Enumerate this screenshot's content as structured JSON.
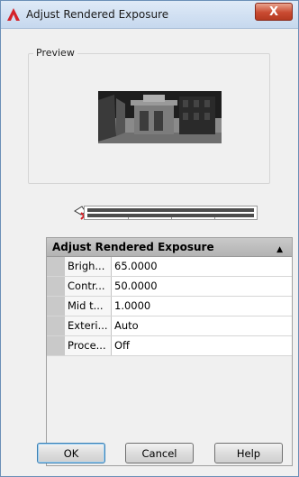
{
  "window": {
    "title": "Adjust Rendered Exposure",
    "close_label": "X"
  },
  "preview": {
    "group_label": "Preview"
  },
  "property_grid": {
    "section_title": "Adjust Rendered Exposure",
    "rows": [
      {
        "name": "Brigh...",
        "value": "65.0000"
      },
      {
        "name": "Contr...",
        "value": "50.0000"
      },
      {
        "name": "Mid t...",
        "value": "1.0000"
      },
      {
        "name": "Exteri...",
        "value": "Auto"
      },
      {
        "name": "Proce...",
        "value": "Off"
      }
    ]
  },
  "buttons": {
    "ok": "OK",
    "cancel": "Cancel",
    "help": "Help"
  },
  "colors": {
    "accent": "#3c7fb1",
    "close": "#c94a31",
    "grid_header": "#b3b3b3"
  }
}
